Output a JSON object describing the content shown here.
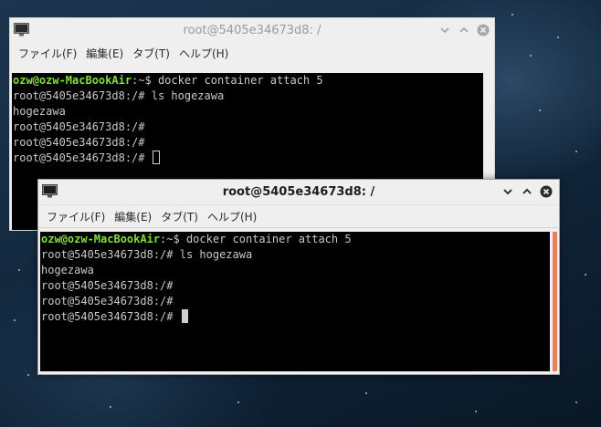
{
  "background": {
    "color": "#142a40"
  },
  "windows": {
    "back": {
      "title": "root@5405e34673d8: /",
      "app_icon": "terminal-icon",
      "menu": [
        "ファイル(F)",
        "編集(E)",
        "タブ(T)",
        "ヘルプ(H)"
      ],
      "prompt_user": "ozw@ozw-MacBookAir",
      "prompt_path": ":~$ ",
      "command": "docker container attach 5",
      "lines": [
        "root@5405e34673d8:/# ls hogezawa",
        "hogezawa",
        "root@5405e34673d8:/#",
        "root@5405e34673d8:/#",
        "root@5405e34673d8:/# "
      ],
      "cursor": "hollow"
    },
    "front": {
      "title": "root@5405e34673d8: /",
      "app_icon": "terminal-icon",
      "menu": [
        "ファイル(F)",
        "編集(E)",
        "タブ(T)",
        "ヘルプ(H)"
      ],
      "prompt_user": "ozw@ozw-MacBookAir",
      "prompt_path": ":~$ ",
      "command": "docker container attach 5",
      "lines": [
        "root@5405e34673d8:/# ls hogezawa",
        "hogezawa",
        "root@5405e34673d8:/#",
        "root@5405e34673d8:/#",
        "root@5405e34673d8:/# "
      ],
      "cursor": "solid",
      "accent_color": "#e8805a"
    }
  },
  "colors": {
    "prompt_user": "#7fe03b",
    "terminal_bg": "#000000",
    "terminal_fg": "#c8c8c8"
  }
}
